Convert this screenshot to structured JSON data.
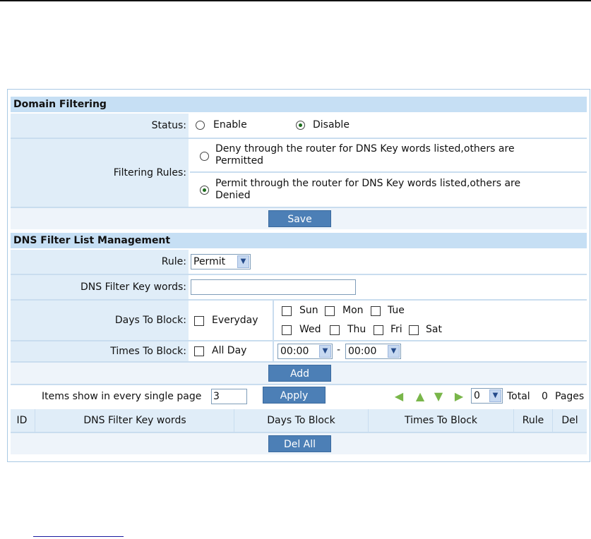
{
  "domain_filtering": {
    "title": "Domain Filtering",
    "status_label": "Status:",
    "status_options": [
      "Enable",
      "Disable"
    ],
    "status_selected": "Disable",
    "rules_label": "Filtering Rules:",
    "rule_deny_line1": "Deny through the router for DNS Key words listed,others are",
    "rule_deny_line2": "Permitted",
    "rule_permit_line1": "Permit through the router for DNS Key words listed,others are",
    "rule_permit_line2": "Denied",
    "rule_selected": "permit",
    "save_label": "Save"
  },
  "dns_filter": {
    "title": "DNS Filter List Management",
    "rule_label": "Rule:",
    "rule_value": "Permit",
    "keywords_label": "DNS Filter Key words:",
    "keywords_value": "",
    "days_label": "Days To Block:",
    "everyday_label": "Everyday",
    "days": [
      "Sun",
      "Mon",
      "Tue",
      "Wed",
      "Thu",
      "Fri",
      "Sat"
    ],
    "times_label": "Times To Block:",
    "allday_label": "All Day",
    "time_from": "00:00",
    "time_dash": "-",
    "time_to": "00:00",
    "add_label": "Add"
  },
  "pager": {
    "items_label": "Items show in every single page",
    "items_value": "3",
    "apply_label": "Apply",
    "page_value": "0",
    "total_label": "Total",
    "total_value": "0",
    "pages_label": "Pages",
    "icons": [
      "first-page-icon",
      "prev-page-icon",
      "next-page-icon",
      "last-page-icon"
    ]
  },
  "table": {
    "columns": [
      "ID",
      "DNS Filter Key words",
      "Days To Block",
      "Times To Block",
      "Rule",
      "Del"
    ],
    "del_all_label": "Del All"
  },
  "colors": {
    "header_bg": "#c6dff4",
    "label_bg": "#e0edf8",
    "button_bg": "#4c7fb6",
    "nav_arrow": "#79b64a"
  }
}
